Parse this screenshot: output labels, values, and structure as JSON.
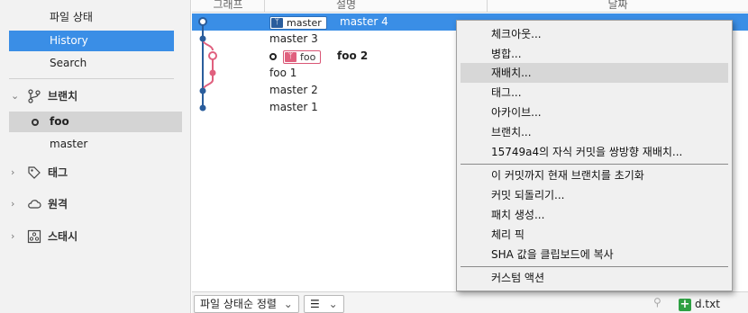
{
  "sidebar": {
    "file_status": "파일 상태",
    "history": "History",
    "search": "Search",
    "branches_header": "브랜치",
    "branches": [
      "foo",
      "master"
    ],
    "tags_header": "태그",
    "remotes_header": "원격",
    "stashes_header": "스태시"
  },
  "columns": {
    "graph": "그래프",
    "description": "설명",
    "date": "날짜"
  },
  "commits": [
    {
      "branch_label": "master",
      "message": "master 4"
    },
    {
      "message": "master 3"
    },
    {
      "branch_label": "foo",
      "message": "foo 2"
    },
    {
      "message": "foo 1"
    },
    {
      "message": "master 2"
    },
    {
      "message": "master 1"
    }
  ],
  "context_menu": {
    "items": [
      "체크아웃...",
      "병합...",
      "재배치...",
      "태그...",
      "아카이브...",
      "브랜치...",
      "15749a4의 자식 커밋을 쌍방향 재배치...",
      "이 커밋까지 현재 브랜치를 초기화",
      "커밋 되돌리기...",
      "패치 생성...",
      "체리 픽",
      "SHA 값을 클립보드에 복사",
      "커스텀 액션"
    ],
    "hovered_item": "재배치..."
  },
  "bottom_bar": {
    "sort_label": "파일 상태순 정렬",
    "file_name": "d.txt"
  },
  "colors": {
    "selection": "#3a8ee6",
    "master_branch": "#2a5d9c",
    "foo_branch": "#e0607e"
  }
}
